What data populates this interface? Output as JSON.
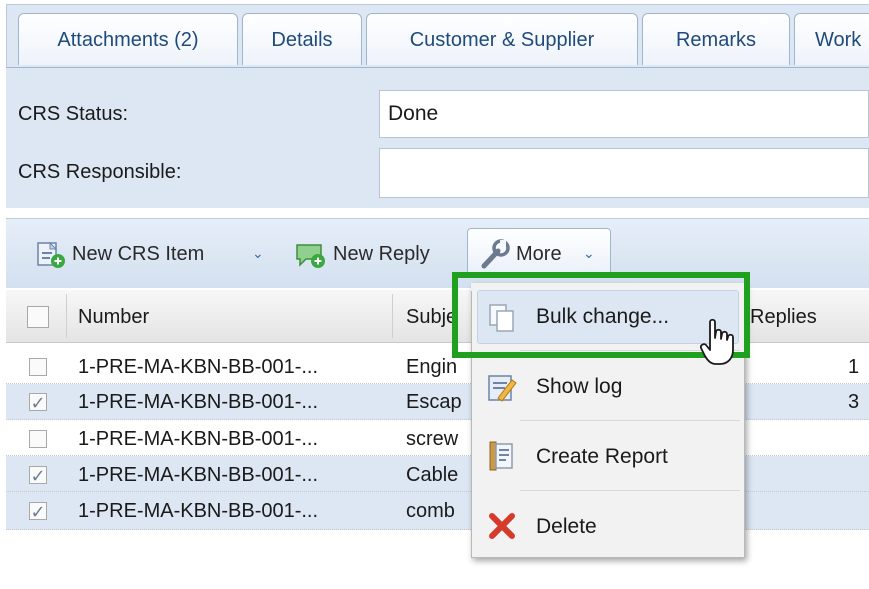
{
  "tabs": [
    {
      "label": "Attachments (2)"
    },
    {
      "label": "Details"
    },
    {
      "label": "Customer & Supplier"
    },
    {
      "label": "Remarks"
    },
    {
      "label": "Work"
    }
  ],
  "form": {
    "status_label": "CRS Status:",
    "status_value": "Done",
    "responsible_label": "CRS Responsible:",
    "responsible_value": ""
  },
  "toolbar": {
    "new_item_label": "New CRS Item",
    "new_reply_label": "New Reply",
    "more_label": "More"
  },
  "grid": {
    "columns": {
      "number": "Number",
      "subject": "Subje",
      "replies": "Replies"
    },
    "rows": [
      {
        "checked": false,
        "number": "1-PRE-MA-KBN-BB-001-...",
        "subject": "Engin",
        "replies": "1"
      },
      {
        "checked": true,
        "number": "1-PRE-MA-KBN-BB-001-...",
        "subject": "Escap",
        "replies": "3"
      },
      {
        "checked": false,
        "number": "1-PRE-MA-KBN-BB-001-...",
        "subject": "screw",
        "replies": ""
      },
      {
        "checked": true,
        "number": "1-PRE-MA-KBN-BB-001-...",
        "subject": "Cable",
        "replies": ""
      },
      {
        "checked": true,
        "number": "1-PRE-MA-KBN-BB-001-...",
        "subject": "comb",
        "replies": ""
      }
    ]
  },
  "menu": {
    "items": [
      {
        "label": "Bulk change...",
        "icon": "copy-icon"
      },
      {
        "label": "Show log",
        "icon": "edit-note-icon"
      },
      {
        "label": "Create Report",
        "icon": "report-icon"
      },
      {
        "label": "Delete",
        "icon": "delete-icon"
      }
    ]
  },
  "colors": {
    "highlight": "#1fa01f",
    "selected_row": "#dde7f3",
    "tab_text": "#1f4a7c"
  }
}
